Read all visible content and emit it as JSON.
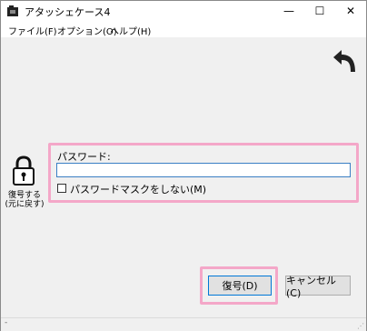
{
  "window": {
    "title": "アタッシェケース4"
  },
  "titlebar_buttons": {
    "minimize": "—",
    "maximize": "☐",
    "close": "✕"
  },
  "menu": [
    {
      "label": "ファイル(F)"
    },
    {
      "label": "オプション(O)"
    },
    {
      "label": "ヘルプ(H)"
    }
  ],
  "side": {
    "lock_label_line1": "復号する",
    "lock_label_line2": "(元に戻す)"
  },
  "password": {
    "label": "パスワード:",
    "value": "",
    "mask_label": "パスワードマスクをしない(M)",
    "mask_checked": false
  },
  "buttons": {
    "restore": "復号(D)",
    "cancel": "キャンセル(C)"
  },
  "status": {
    "text": "-"
  },
  "colors": {
    "highlight": "#f4a7c8",
    "input_border": "#3a7fc4",
    "background": "#f0f0f0"
  },
  "icons": {
    "back": "undo-arrow-icon",
    "lock": "padlock-icon",
    "app": "app-icon"
  }
}
